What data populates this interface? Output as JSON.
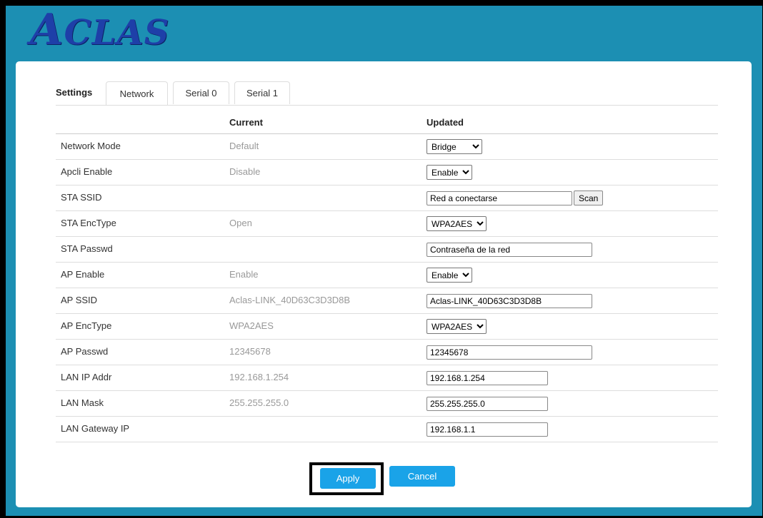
{
  "brand": {
    "logo_first": "A",
    "logo_rest": "CLAS"
  },
  "tabs": {
    "label": "Settings",
    "items": [
      "Network",
      "Serial 0",
      "Serial 1"
    ]
  },
  "table": {
    "header_current": "Current",
    "header_updated": "Updated",
    "rows": [
      {
        "label": "Network Mode",
        "current": "Default",
        "type": "select",
        "value": "Bridge"
      },
      {
        "label": "Apcli Enable",
        "current": "Disable",
        "type": "select",
        "value": "Enable"
      },
      {
        "label": "STA SSID",
        "current": "",
        "type": "text-scan",
        "value": "Red a conectarse"
      },
      {
        "label": "STA EncType",
        "current": "Open",
        "type": "select",
        "value": "WPA2AES"
      },
      {
        "label": "STA Passwd",
        "current": "",
        "type": "text",
        "value": "Contraseña de la red"
      },
      {
        "label": "AP Enable",
        "current": "Enable",
        "type": "select",
        "value": "Enable"
      },
      {
        "label": "AP SSID",
        "current": "Aclas-LINK_40D63C3D3D8B",
        "type": "text",
        "value": "Aclas-LINK_40D63C3D3D8B"
      },
      {
        "label": "AP EncType",
        "current": "WPA2AES",
        "type": "select",
        "value": "WPA2AES"
      },
      {
        "label": "AP Passwd",
        "current": "12345678",
        "type": "text",
        "value": "12345678"
      },
      {
        "label": "LAN IP Addr",
        "current": "192.168.1.254",
        "type": "text-short",
        "value": "192.168.1.254"
      },
      {
        "label": "LAN Mask",
        "current": "255.255.255.0",
        "type": "text-short",
        "value": "255.255.255.0"
      },
      {
        "label": "LAN Gateway IP",
        "current": "",
        "type": "text-short",
        "value": "192.168.1.1"
      }
    ]
  },
  "scan_label": "Scan",
  "actions": {
    "apply": "Apply",
    "cancel": "Cancel"
  },
  "colors": {
    "frame": "#1c8fb3",
    "button": "#1aa3e8",
    "logo": "#1e3fa8"
  }
}
